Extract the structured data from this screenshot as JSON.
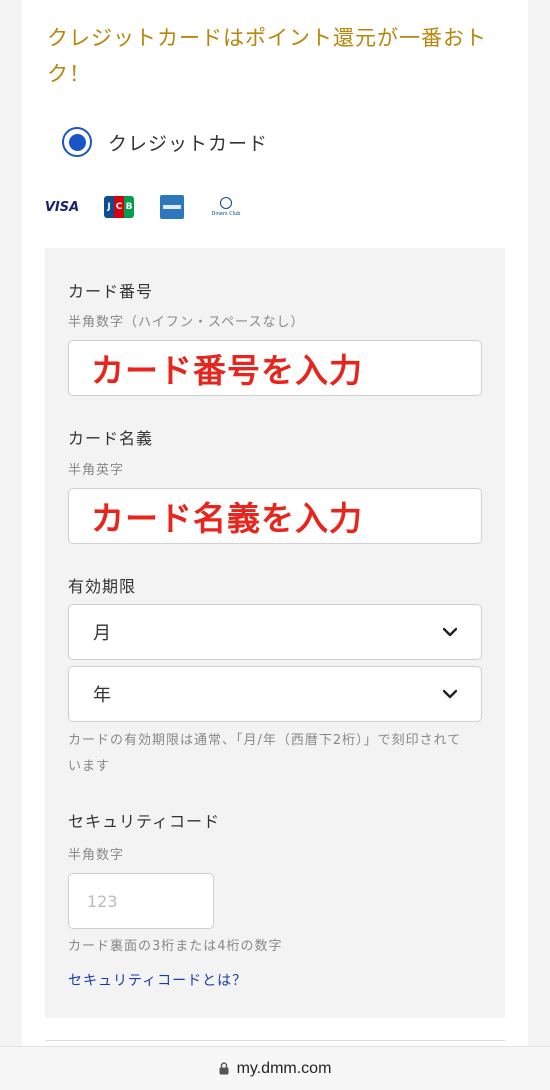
{
  "promo_text": "クレジットカードはポイント還元が一番おトク！",
  "payment_method": {
    "label": "クレジットカード",
    "selected": true
  },
  "brands": {
    "visa": "VISA",
    "jcb": "JCB",
    "amex": "AMERICAN EXPRESS",
    "diners": "Diners Club INTERNATIONAL"
  },
  "card_number": {
    "label": "カード番号",
    "hint": "半角数字（ハイフン・スペースなし）",
    "overlay": "カード番号を入力"
  },
  "card_name": {
    "label": "カード名義",
    "hint": "半角英字",
    "overlay": "カード名義を入力"
  },
  "expiry": {
    "label": "有効期限",
    "month": "月",
    "year": "年",
    "note": "カードの有効期限は通常、「月/年（西暦下2桁）」で刻印されています"
  },
  "security": {
    "label": "セキュリティコード",
    "hint": "半角数字",
    "placeholder": "123",
    "note": "カード裏面の3桁または4桁の数字",
    "link": "セキュリティコードとは？"
  },
  "browser": {
    "url": "my.dmm.com"
  },
  "colors": {
    "accent": "#1a55c6",
    "promo": "#b8860b",
    "overlay": "#e8251c",
    "link": "#1a3ba8"
  }
}
